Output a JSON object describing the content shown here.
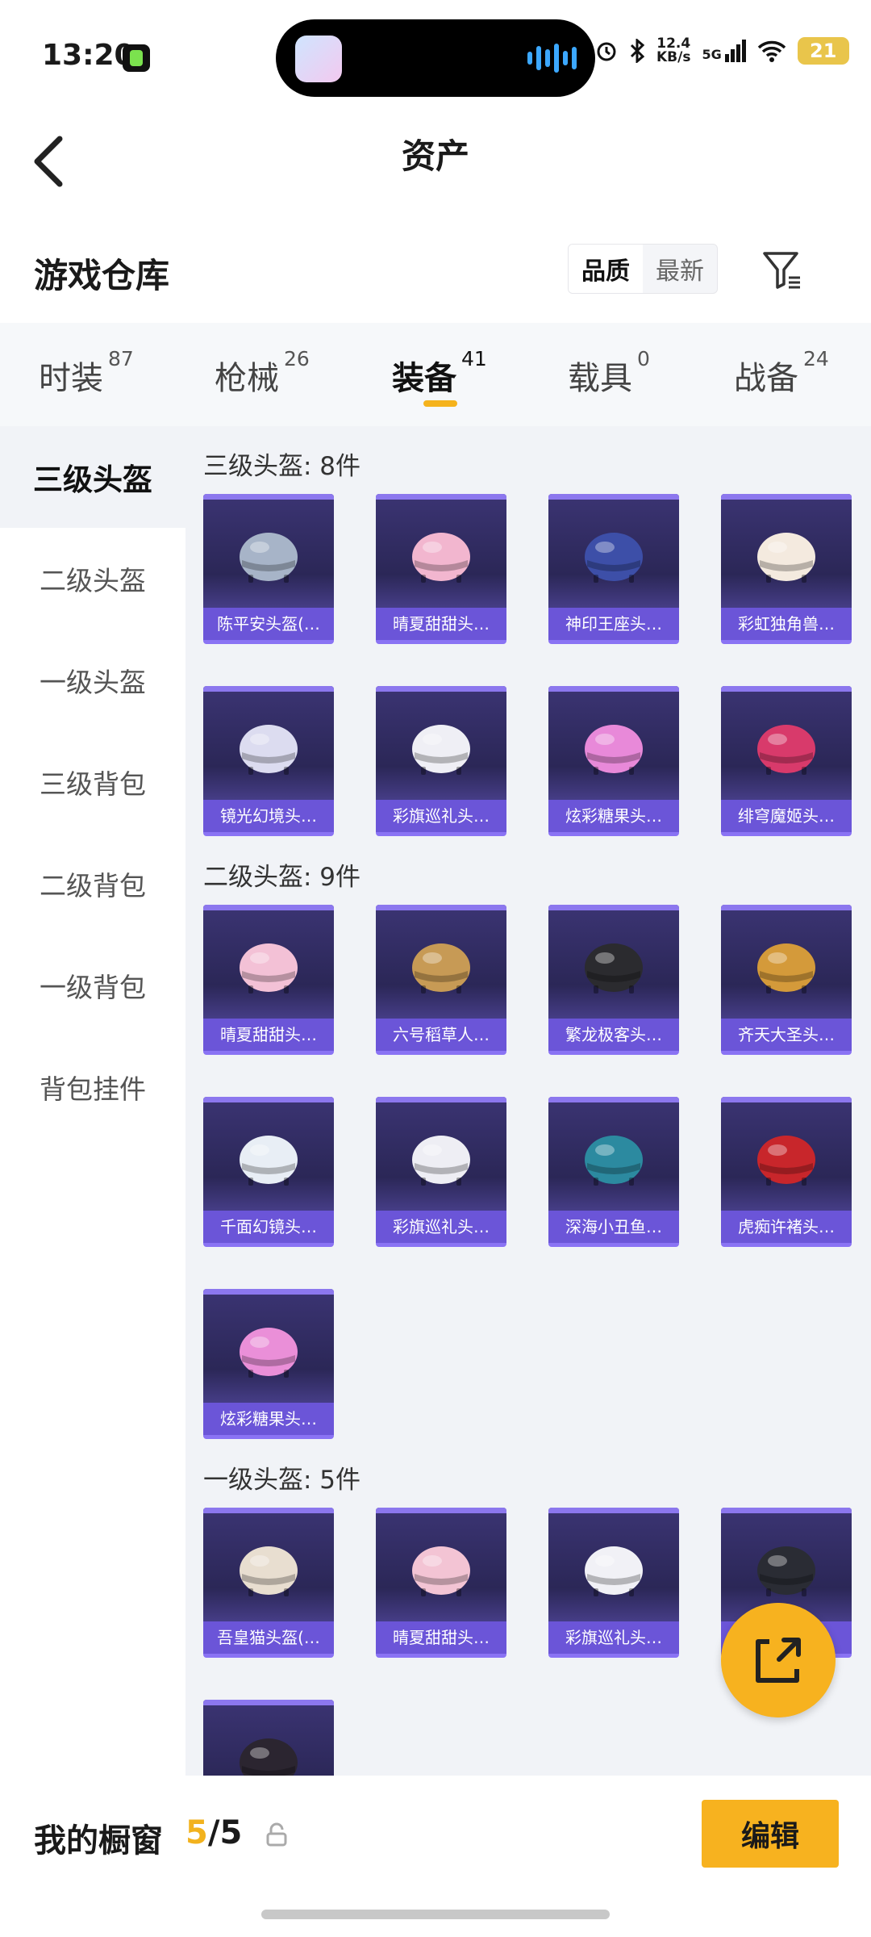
{
  "status_bar": {
    "time": "13:20",
    "net_speed_value": "12.4",
    "net_speed_unit": "KB/s",
    "network": "5G",
    "battery": "21"
  },
  "header": {
    "title": "资产",
    "back_icon": "chevron-left-icon"
  },
  "warehouse": {
    "title": "游戏仓库",
    "sort_options": [
      "品质",
      "最新"
    ],
    "sort_selected": "品质",
    "filter_icon": "filter-icon"
  },
  "tabs": [
    {
      "label": "时装",
      "count": "87"
    },
    {
      "label": "枪械",
      "count": "26"
    },
    {
      "label": "装备",
      "count": "41",
      "active": true
    },
    {
      "label": "载具",
      "count": "0"
    },
    {
      "label": "战备",
      "count": "24"
    }
  ],
  "sidebar": [
    "三级头盔",
    "二级头盔",
    "一级头盔",
    "三级背包",
    "二级背包",
    "一级背包",
    "背包挂件"
  ],
  "sidebar_selected": "三级头盔",
  "groups": [
    {
      "title": "三级头盔: 8件",
      "items": [
        {
          "name": "陈平安头盔(…",
          "color": "#a7b4c8"
        },
        {
          "name": "晴夏甜甜头…",
          "color": "#f2b6cf"
        },
        {
          "name": "神印王座头…",
          "color": "#3d4fa8"
        },
        {
          "name": "彩虹独角兽…",
          "color": "#f4eadf"
        },
        {
          "name": "镜光幻境头…",
          "color": "#dcdcf0"
        },
        {
          "name": "彩旗巡礼头…",
          "color": "#efeff5"
        },
        {
          "name": "炫彩糖果头…",
          "color": "#e889d9"
        },
        {
          "name": "绯穹魔姬头…",
          "color": "#d83a6b"
        }
      ]
    },
    {
      "title": "二级头盔: 9件",
      "items": [
        {
          "name": "晴夏甜甜头…",
          "color": "#f3c1d6"
        },
        {
          "name": "六号稻草人…",
          "color": "#c79a55"
        },
        {
          "name": "繁龙极客头…",
          "color": "#2b2b2f"
        },
        {
          "name": "齐天大圣头…",
          "color": "#d49a3a"
        },
        {
          "name": "千面幻镜头…",
          "color": "#e8eef5"
        },
        {
          "name": "彩旗巡礼头…",
          "color": "#eeeef4"
        },
        {
          "name": "深海小丑鱼…",
          "color": "#2c8aa0"
        },
        {
          "name": "虎痴许褚头…",
          "color": "#c8262b"
        },
        {
          "name": "炫彩糖果头…",
          "color": "#ea8fd8"
        }
      ]
    },
    {
      "title": "一级头盔: 5件",
      "items": [
        {
          "name": "吾皇猫头盔(…",
          "color": "#e8ded0"
        },
        {
          "name": "晴夏甜甜头…",
          "color": "#f3c4d4"
        },
        {
          "name": "彩旗巡礼头…",
          "color": "#f1f1f6"
        },
        {
          "name": "",
          "color": "#2a2c34"
        },
        {
          "name": "",
          "color": "#2b2530"
        }
      ]
    }
  ],
  "fab_icon": "share-external-icon",
  "showcase": {
    "label": "我的橱窗",
    "current": "5",
    "total": "5",
    "lock_icon": "lock-icon",
    "edit_label": "编辑"
  },
  "colors": {
    "accent": "#f7b21f",
    "card_label": "#6b55d8",
    "card_bg": "#2b2757"
  }
}
